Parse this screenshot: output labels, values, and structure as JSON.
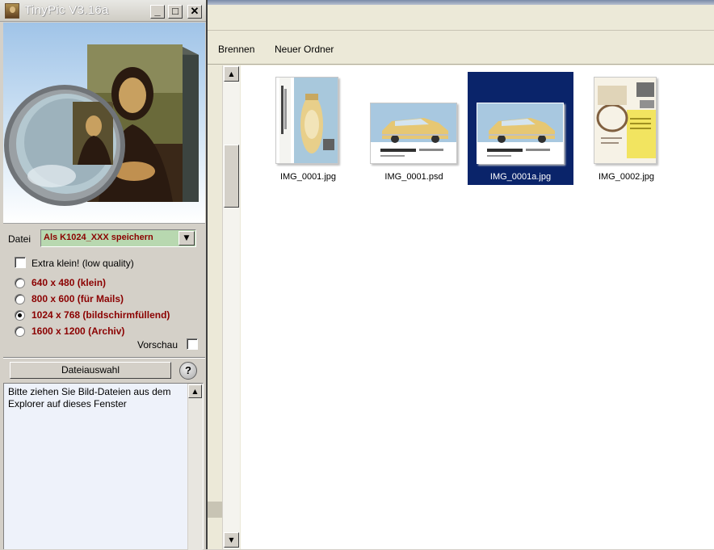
{
  "explorer": {
    "toolbar": {
      "burn_label": "Brennen",
      "new_folder_label": "Neuer Ordner"
    },
    "files": [
      {
        "name": "IMG_0001.jpg",
        "selected": false
      },
      {
        "name": "IMG_0001.psd",
        "selected": false
      },
      {
        "name": "IMG_0001a.jpg",
        "selected": true
      },
      {
        "name": "IMG_0002.jpg",
        "selected": false
      }
    ],
    "selection_color": "#0a246a"
  },
  "tinypic": {
    "title": "TinyPic V3.16a",
    "window_buttons": {
      "minimize": "_",
      "maximize": "□",
      "close": "✕"
    },
    "datei_label": "Datei",
    "dropdown_value": "Als K1024_XXX speichern",
    "extra_klein_label": "Extra klein! (low quality)",
    "sizes": [
      {
        "label": "640 x 480 (klein)",
        "selected": false
      },
      {
        "label": "800 x 600 (für Mails)",
        "selected": false
      },
      {
        "label": "1024 x 768 (bildschirmfüllend)",
        "selected": true
      },
      {
        "label": "1600 x 1200 (Archiv)",
        "selected": false
      }
    ],
    "vorschau_label": "Vorschau",
    "dateiauswahl_label": "Dateiauswahl",
    "help_label": "?",
    "message": "Bitte ziehen Sie Bild-Dateien aus dem Explorer auf dieses Fenster",
    "accent_color": "#8b0000"
  }
}
